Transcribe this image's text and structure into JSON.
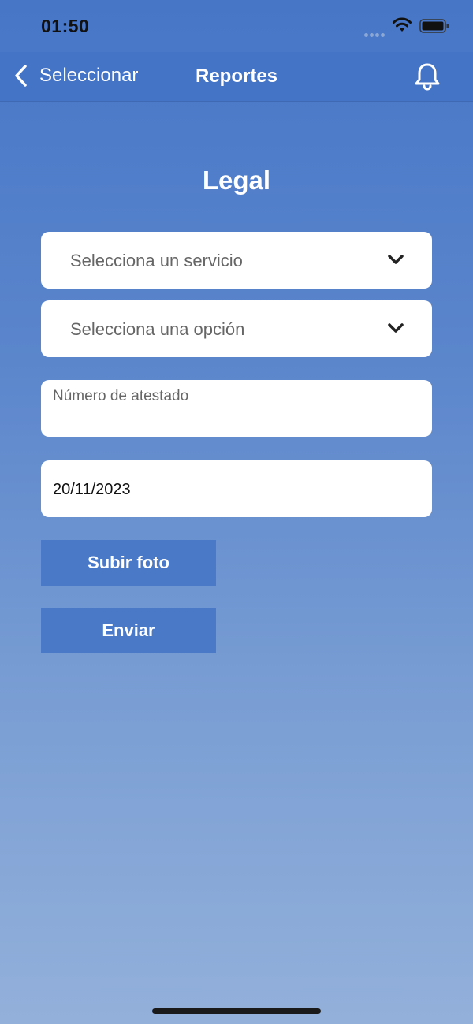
{
  "status_bar": {
    "time": "01:50"
  },
  "nav": {
    "back_label": "Seleccionar",
    "title": "Reportes"
  },
  "page": {
    "title": "Legal"
  },
  "form": {
    "service_select": {
      "label": "Selecciona un servicio"
    },
    "option_select": {
      "label": "Selecciona una opción"
    },
    "report_number": {
      "placeholder": "Número de atestado",
      "value": ""
    },
    "date": {
      "value": "20/11/2023"
    },
    "upload_photo_label": "Subir foto",
    "submit_label": "Enviar"
  },
  "icons": [
    "chevron-left-icon",
    "bell-icon",
    "chevron-down-icon",
    "wifi-icon",
    "battery-icon"
  ],
  "colors": {
    "nav_background": "#4474c6",
    "button_background": "#4a79c8",
    "text_white": "#ffffff"
  }
}
